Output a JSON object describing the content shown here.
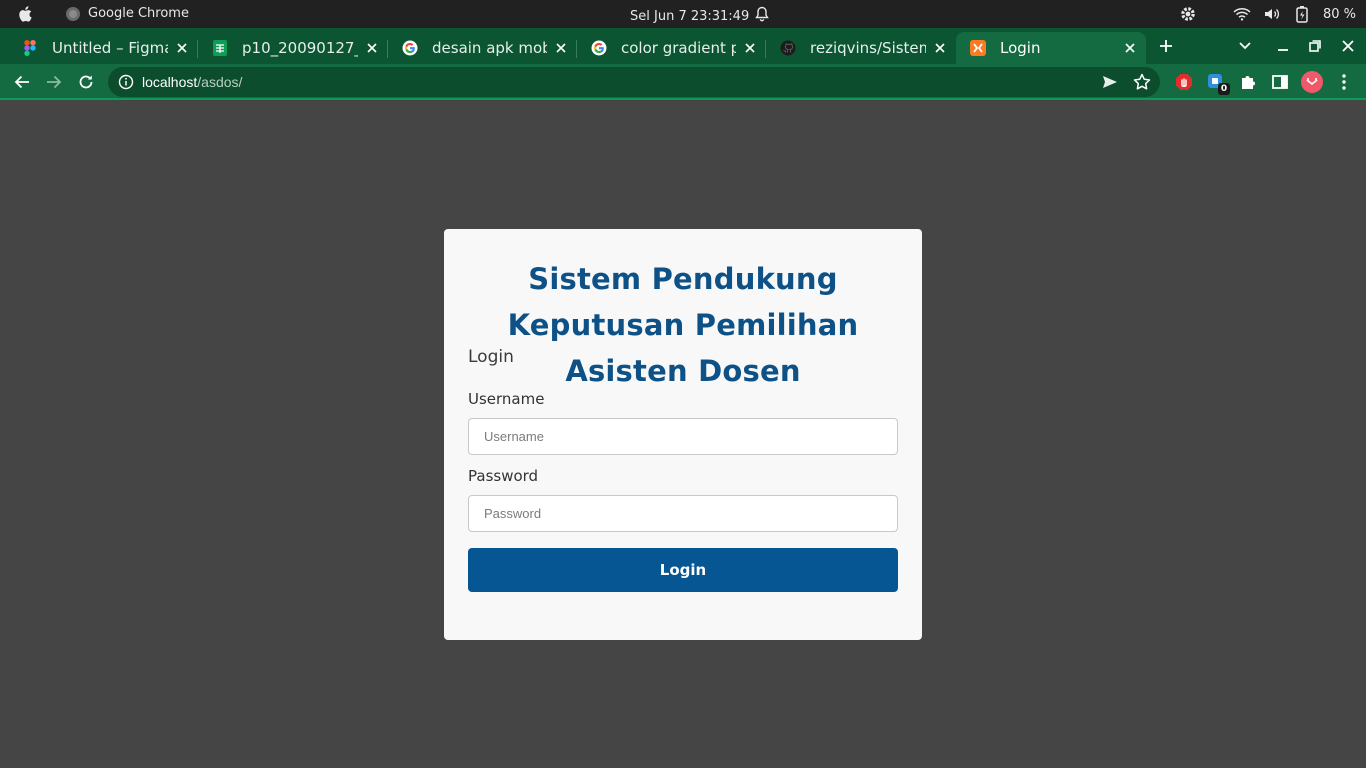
{
  "os": {
    "app_name": "Google Chrome",
    "clock": "Sel Jun 7  23:31:49",
    "battery": "80 %"
  },
  "tabs": [
    {
      "title": "Untitled – Figma",
      "icon": "figma-icon"
    },
    {
      "title": "p10_20090127_Mu",
      "icon": "sheets-icon"
    },
    {
      "title": "desain apk mobile",
      "icon": "google-icon"
    },
    {
      "title": "color gradient por",
      "icon": "google-icon"
    },
    {
      "title": "reziqvins/Sistem-P",
      "icon": "github-icon"
    },
    {
      "title": "Login",
      "icon": "xampp-icon",
      "active": true
    }
  ],
  "address": {
    "host": "localhost",
    "path": "/asdos/"
  },
  "extensions": {
    "badge_count": "0"
  },
  "login": {
    "heading": "Sistem Pendukung Keputusan Pemilihan Asisten Dosen",
    "subtitle": "Login",
    "username_label": "Username",
    "username_placeholder": "Username",
    "username_value": "",
    "password_label": "Password",
    "password_placeholder": "Password",
    "password_value": "",
    "submit_label": "Login"
  },
  "colors": {
    "chrome_frame": "#0b5533",
    "chrome_toolbar": "#146b41",
    "page_bg": "#454545",
    "card_bg": "#f8f8f8",
    "heading": "#0d5186",
    "button": "#075694"
  }
}
